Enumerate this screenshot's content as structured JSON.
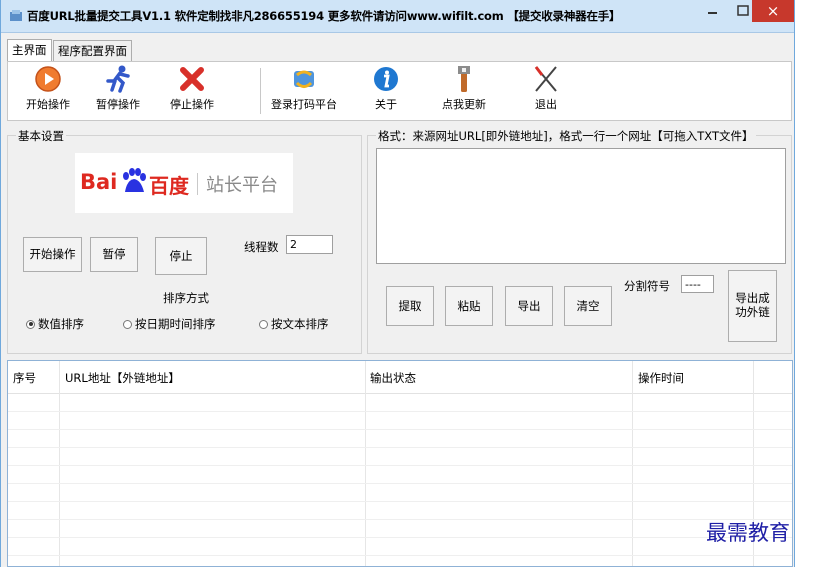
{
  "window": {
    "title": "百度URL批量提交工具V1.1 软件定制找非凡286655194 更多软件请访问www.wifilt.com 【提交收录神器在手】",
    "close_glyph": "×"
  },
  "tabs": [
    {
      "label": "主界面"
    },
    {
      "label": "程序配置界面"
    }
  ],
  "toolbar": {
    "start": "开始操作",
    "pause": "暂停操作",
    "stop": "停止操作",
    "captcha": "登录打码平台",
    "about": "关于",
    "update": "点我更新",
    "exit": "退出"
  },
  "basic": {
    "title": "基本设置",
    "logo_bai": "Bai",
    "logo_baidu": "百度",
    "logo_platform": "站长平台",
    "start_btn": "开始操作",
    "pause_btn": "暂停",
    "stop_btn": "停止",
    "threads_label": "线程数",
    "threads_value": "2",
    "sort_label": "排序方式",
    "sort_options": [
      {
        "label": "数值排序",
        "selected": true
      },
      {
        "label": "按日期时间排序",
        "selected": false
      },
      {
        "label": "按文本排序",
        "selected": false
      }
    ]
  },
  "format": {
    "title": "格式：来源网址URL[即外链地址]，格式一行一个网址【可拖入TXT文件】",
    "textarea_value": "",
    "extract_btn": "提取",
    "paste_btn": "粘贴",
    "export_btn": "导出",
    "clear_btn": "清空",
    "separator_label": "分割符号",
    "separator_value": "----",
    "export_success_line1": "导出成",
    "export_success_line2": "功外链"
  },
  "table": {
    "columns": [
      "序号",
      "URL地址【外链地址】",
      "输出状态",
      "操作时间"
    ],
    "rows": []
  },
  "watermark": "最需教育",
  "colors": {
    "title_bg": "#cfe4f7",
    "close_red": "#c7382c",
    "baidu_red": "#de2920",
    "baidu_blue": "#2932e1"
  }
}
